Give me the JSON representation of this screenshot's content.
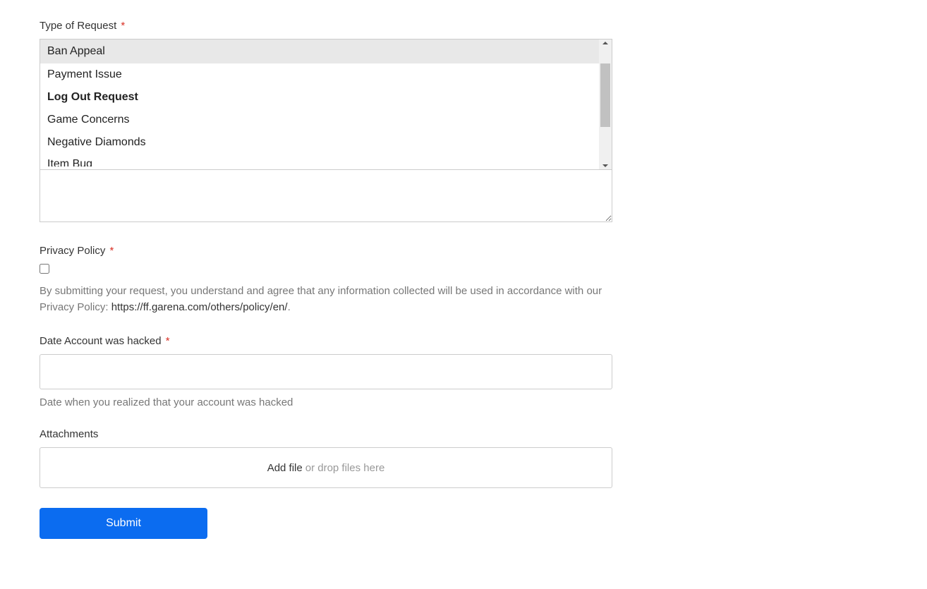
{
  "fields": {
    "typeOfRequest": {
      "label": "Type of Request",
      "selected": "Ban Appeal",
      "options": [
        {
          "label": "Payment Issue",
          "bold": false
        },
        {
          "label": "Log Out Request",
          "bold": true
        },
        {
          "label": "Game Concerns",
          "bold": false
        },
        {
          "label": "Negative Diamonds",
          "bold": false
        },
        {
          "label": "Item Bug",
          "bold": false
        }
      ]
    },
    "privacyPolicy": {
      "label": "Privacy Policy",
      "helpPrefix": "By submitting your request, you understand and agree that any information collected will be used in accordance with our Privacy Policy: ",
      "helpLink": "https://ff.garena.com/others/policy/en/",
      "helpSuffix": "."
    },
    "dateHacked": {
      "label": "Date Account was hacked",
      "help": "Date when you realized that your account was hacked"
    },
    "attachments": {
      "label": "Attachments",
      "addText": "Add file",
      "dropText": "or drop files here"
    }
  },
  "buttons": {
    "submit": "Submit"
  },
  "symbols": {
    "required": "*"
  }
}
